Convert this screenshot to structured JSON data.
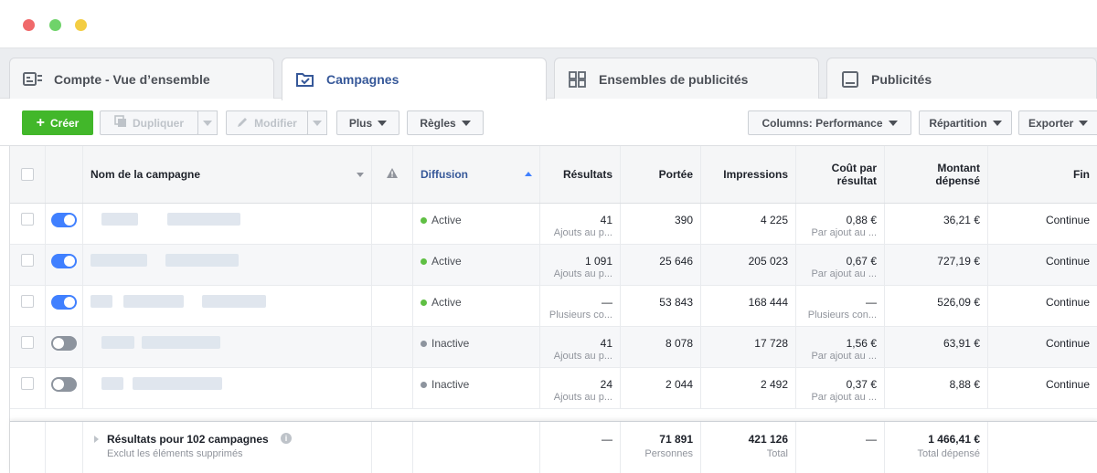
{
  "tabs": [
    {
      "label": "Compte - Vue d’ensemble"
    },
    {
      "label": "Campagnes"
    },
    {
      "label": "Ensembles de publicités"
    },
    {
      "label": "Publicités"
    }
  ],
  "toolbar": {
    "create": "Créer",
    "duplicate": "Dupliquer",
    "edit": "Modifier",
    "more": "Plus",
    "rules": "Règles",
    "columns_prefix": "Columns: ",
    "columns_value": "Performance",
    "breakdown": "Répartition",
    "export": "Exporter"
  },
  "headers": {
    "name": "Nom de la campagne",
    "delivery": "Diffusion",
    "results": "Résultats",
    "reach": "Portée",
    "impressions": "Impressions",
    "cost_1": "Coût par",
    "cost_2": "résultat",
    "spent_1": "Montant",
    "spent_2": "dépensé",
    "end": "Fin"
  },
  "rows": [
    {
      "delivery": "Active",
      "results": "41",
      "results_sub": "Ajouts au p...",
      "reach": "390",
      "impressions": "4 225",
      "cost": "0,88 €",
      "cost_sub": "Par ajout au ...",
      "spent": "36,21 €",
      "end": "Continue"
    },
    {
      "delivery": "Active",
      "results": "1 091",
      "results_sub": "Ajouts au p...",
      "reach": "25 646",
      "impressions": "205 023",
      "cost": "0,67 €",
      "cost_sub": "Par ajout au ...",
      "spent": "727,19 €",
      "end": "Continue"
    },
    {
      "delivery": "Active",
      "results": "—",
      "results_sub": "Plusieurs co...",
      "reach": "53 843",
      "impressions": "168 444",
      "cost": "—",
      "cost_sub": "Plusieurs con...",
      "spent": "526,09 €",
      "end": "Continue"
    },
    {
      "delivery": "Inactive",
      "results": "41",
      "results_sub": "Ajouts au p...",
      "reach": "8 078",
      "impressions": "17 728",
      "cost": "1,56 €",
      "cost_sub": "Par ajout au ...",
      "spent": "63,91 €",
      "end": "Continue"
    },
    {
      "delivery": "Inactive",
      "results": "24",
      "results_sub": "Ajouts au p...",
      "reach": "2 044",
      "impressions": "2 492",
      "cost": "0,37 €",
      "cost_sub": "Par ajout au ...",
      "spent": "8,88 €",
      "end": "Continue"
    }
  ],
  "footer": {
    "title": "Résultats pour 102 campagnes",
    "subtitle": "Exclut les éléments supprimés",
    "results": "—",
    "reach": "71 891",
    "reach_sub": "Personnes",
    "impressions": "421 126",
    "impressions_sub": "Total",
    "cost": "—",
    "spent": "1 466,41 €",
    "spent_sub": "Total dépensé"
  },
  "colors": {
    "accent": "#365899",
    "toggle_on": "#4080ff",
    "toggle_off": "#8d949e",
    "active_dot": "#5fbf43",
    "inactive_dot": "#8d949e",
    "create_button": "#42b72a"
  }
}
